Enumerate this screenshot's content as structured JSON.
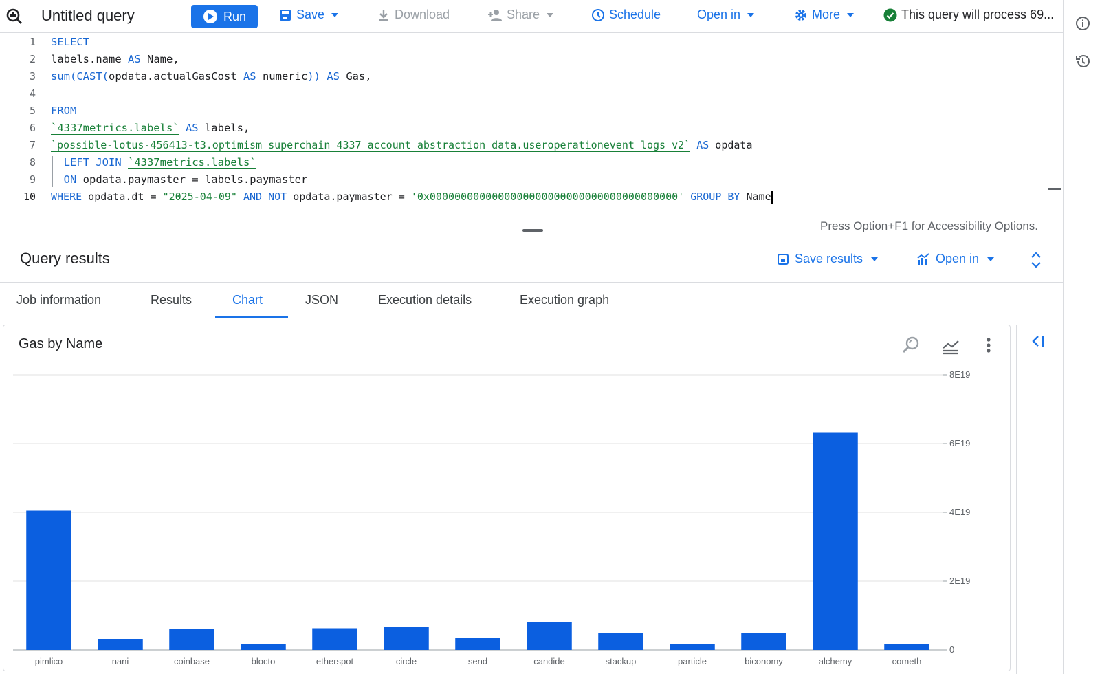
{
  "toolbar": {
    "title": "Untitled query",
    "run": "Run",
    "save": "Save",
    "download": "Download",
    "share": "Share",
    "schedule": "Schedule",
    "open_in": "Open in",
    "more": "More",
    "status": "This query will process 69..."
  },
  "editor": {
    "line_numbers": [
      "1",
      "2",
      "3",
      "4",
      "5",
      "6",
      "7",
      "8",
      "9",
      "10"
    ],
    "line1": "SELECT",
    "line2_a": "labels.name ",
    "line2_kw": "AS",
    "line2_b": " Name,",
    "line3_fn": "sum(CAST(",
    "line3_a": "opdata.actualGasCost ",
    "line3_kw1": "AS",
    "line3_b": " numeric",
    "line3_fn2": "))",
    "line3_c": " ",
    "line3_kw2": "AS",
    "line3_d": " Gas,",
    "line5": "FROM",
    "line6_tbl": "`4337metrics.labels`",
    "line6_kw": " AS",
    "line6_b": " labels,",
    "line7_tbl": "`possible-lotus-456413-t3.optimism_superchain_4337_account_abstraction_data.useroperationevent_logs_v2`",
    "line7_kw": " AS",
    "line7_b": " opdata",
    "line8_kw": "  LEFT JOIN ",
    "line8_tbl": "`4337metrics.labels`",
    "line9_kw": "  ON",
    "line9_b": " opdata.paymaster = labels.paymaster",
    "line10_kw1": "WHERE",
    "line10_a": " opdata.dt = ",
    "line10_str1": "\"2025-04-09\"",
    "line10_kw2": " AND NOT",
    "line10_b": " opdata.paymaster = ",
    "line10_str2": "'0x0000000000000000000000000000000000000000'",
    "line10_kw3": " GROUP BY",
    "line10_c": " Name",
    "accessibility_hint": "Press Option+F1 for Accessibility Options."
  },
  "results": {
    "title": "Query results",
    "save_results": "Save results",
    "open_in": "Open in",
    "tabs": [
      "Job information",
      "Results",
      "Chart",
      "JSON",
      "Execution details",
      "Execution graph"
    ],
    "active_tab": "Chart"
  },
  "chart_data": {
    "type": "bar",
    "title": "Gas by Name",
    "categories": [
      "pimlico",
      "nani",
      "coinbase",
      "blocto",
      "etherspot",
      "circle",
      "send",
      "candide",
      "stackup",
      "particle",
      "biconomy",
      "alchemy",
      "cometh"
    ],
    "values": [
      4.05e+19,
      3.2e+18,
      6.2e+18,
      1.6e+18,
      6.3e+18,
      6.6e+18,
      3.5e+18,
      8e+18,
      5e+18,
      1.6e+18,
      5e+18,
      6.33e+19,
      1.6e+18
    ],
    "ylim": [
      0,
      8e+19
    ],
    "ticks": [
      0,
      2e+19,
      4e+19,
      6e+19,
      8e+19
    ],
    "tick_labels": [
      "0",
      "2E19",
      "4E19",
      "6E19",
      "8E19"
    ],
    "xlabel": "",
    "ylabel": "",
    "bar_color": "#0b5fe0",
    "grid": true,
    "y_axis_side": "right"
  },
  "colors": {
    "accent": "#1a73e8",
    "success": "#188038"
  }
}
